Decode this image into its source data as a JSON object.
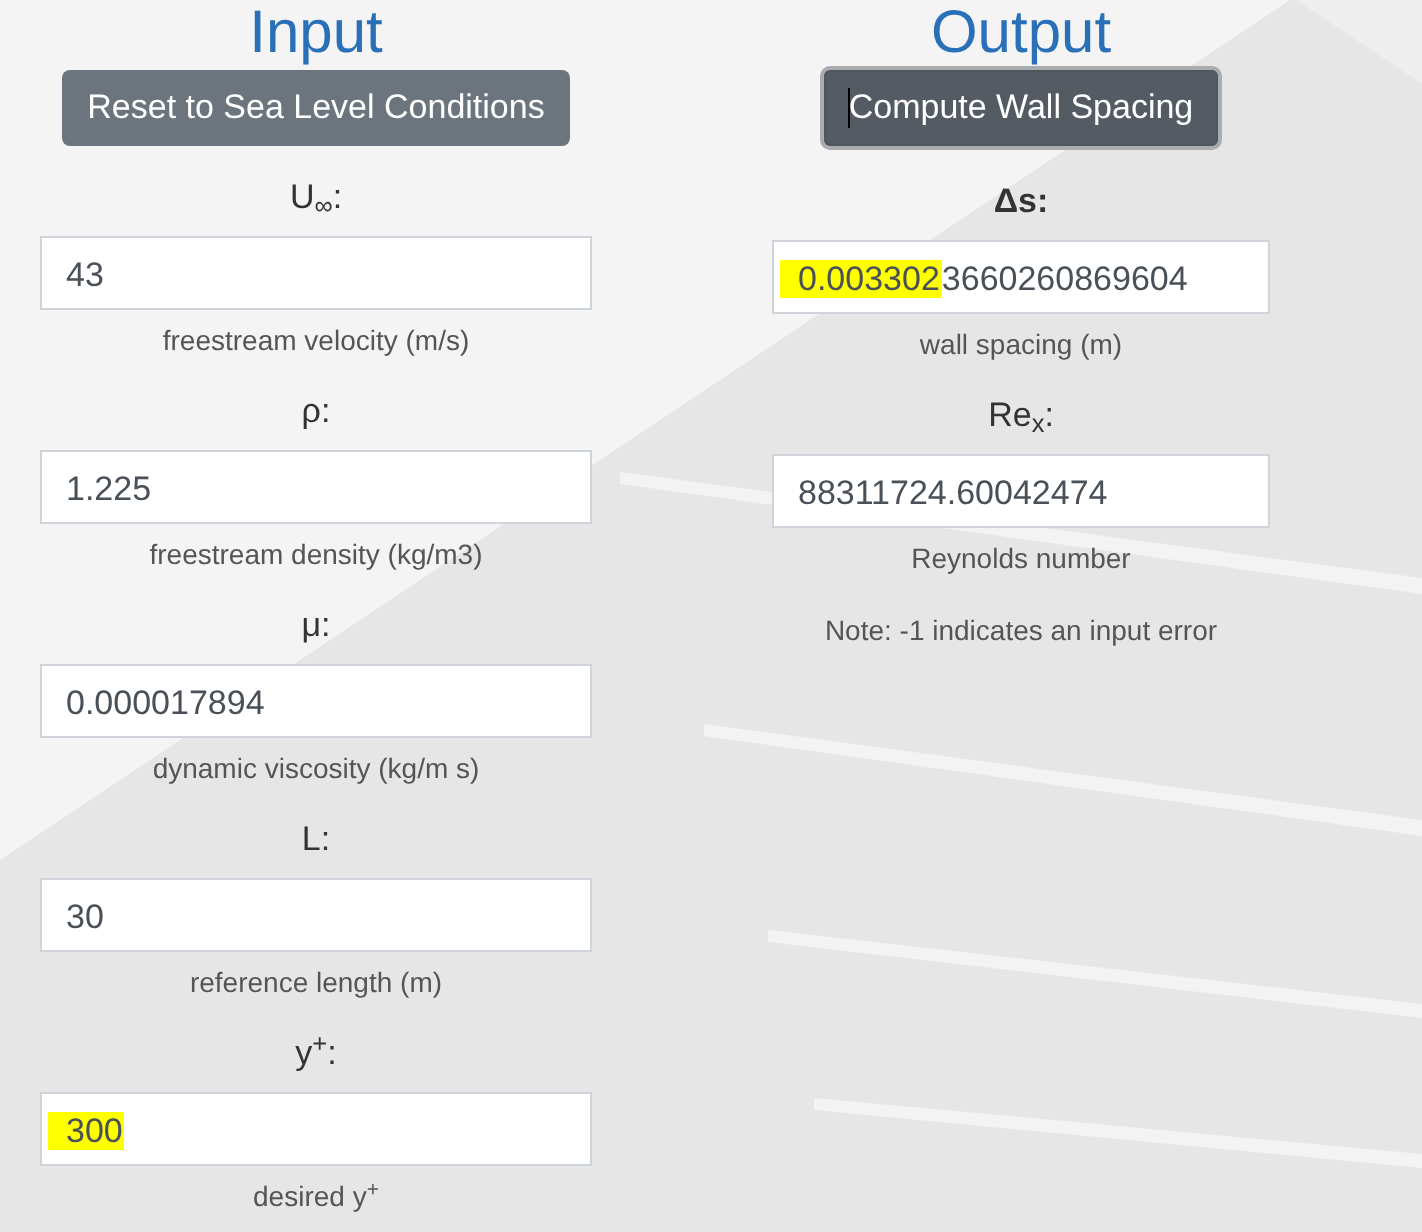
{
  "input_section": {
    "heading": "Input",
    "button": {
      "label": "Reset to Sea Level Conditions",
      "focused": false,
      "text_cursor": false
    },
    "fields": [
      {
        "label": "U$_{∞}$:",
        "label_bold": false,
        "value": [
          {
            "text": "43",
            "highlighted": false
          }
        ],
        "caption": "freestream velocity (m/s)"
      },
      {
        "label": "ρ:",
        "label_bold": false,
        "value": [
          {
            "text": "1.225",
            "highlighted": false
          }
        ],
        "caption": "freestream density (kg/m3)"
      },
      {
        "label": "μ:",
        "label_bold": false,
        "value": [
          {
            "text": "0.000017894",
            "highlighted": false
          }
        ],
        "caption": "dynamic viscosity (kg/m s)"
      },
      {
        "label": "L:",
        "label_bold": false,
        "value": [
          {
            "text": "30",
            "highlighted": false
          }
        ],
        "caption": "reference length (m)"
      },
      {
        "label": "y$^{+}$:",
        "label_bold": false,
        "value": [
          {
            "text": "300",
            "highlighted": true
          }
        ],
        "caption": "desired y$^{+}$"
      }
    ]
  },
  "output_section": {
    "heading": "Output",
    "button": {
      "label": "Compute Wall Spacing",
      "focused": true,
      "text_cursor": true
    },
    "fields": [
      {
        "label": "Δs:",
        "label_bold": true,
        "value": [
          {
            "text": "0.003302",
            "highlighted": true
          },
          {
            "text": "3660260869604",
            "highlighted": false
          }
        ],
        "caption": "wall spacing (m)"
      },
      {
        "label": "Re$_{x}$:",
        "label_bold": false,
        "value": [
          {
            "text": "88311724.60042474",
            "highlighted": false
          }
        ],
        "caption": "Reynolds number"
      }
    ],
    "note": "Note: -1 indicates an input error"
  }
}
